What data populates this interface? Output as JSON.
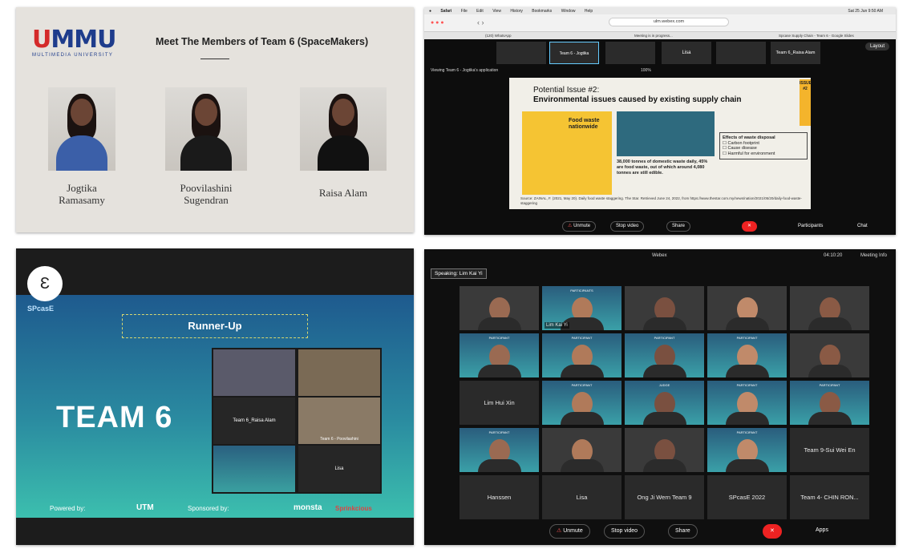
{
  "panel1": {
    "logo_text": "MMU",
    "logo_sub": "MULTIMEDIA UNIVERSITY",
    "title": "Meet The Members of Team 6 (SpaceMakers)",
    "members": [
      {
        "line1": "Jogtika",
        "line2": "Ramasamy"
      },
      {
        "line1": "Poovilashini",
        "line2": "Sugendran"
      },
      {
        "line1": "Raisa Alam",
        "line2": ""
      }
    ]
  },
  "panel2": {
    "menubar": [
      "Safari",
      "File",
      "Edit",
      "View",
      "History",
      "Bookmarks",
      "Window",
      "Help"
    ],
    "clock": "Sat 25 Jun 9:50 AM",
    "url": "ulm.webex.com",
    "tabs": [
      "(120) WhatsApp",
      "Meeting is in progress...",
      "Spcase Supply Chain - Team 6 - Google Slides"
    ],
    "strip": [
      "",
      "Team 6 - Jogtika",
      "",
      "Lisa",
      "",
      "Team 6_Raisa Alam"
    ],
    "layout_label": "Layout",
    "viewing": "Viewing Team 6 - Jogtika's application",
    "zoom": "100%",
    "slide": {
      "title1": "Potential Issue #2:",
      "title2": "Environmental issues caused by existing supply chain",
      "issue_tag": "ISSUE #2",
      "food_waste": "Food waste nationwide",
      "stats": "38,000 tonnes of domestic waste daily, 45% are food waste, out of which around 4,080 tonnes are still edible.",
      "effects_title": "Effects of waste disposal",
      "effects": [
        "Carbon footprint",
        "Cause disease",
        "Harmful for environment"
      ],
      "source": "Source: ZAINAL, F. (2021, May 20). Daily food waste staggering. The Star. Retrieved June 24, 2022, from https://www.thestar.com.my/news/nation/2021/05/20/daily-food-waste-staggering"
    },
    "controls": [
      "Unmute",
      "Stop video",
      "Share"
    ],
    "right_controls": [
      "Participants",
      "Chat"
    ]
  },
  "panel3": {
    "pen_glyph": "Ɛ",
    "spcase": "SPcasE",
    "runner_up": "Runner-Up",
    "team": "TEAM 6",
    "tiles": [
      "",
      "",
      "Team 6_Raisa Alam",
      "Team 6 - Poovilashini",
      "",
      "Lisa"
    ],
    "powered_by": "Powered by:",
    "utm": "UTM",
    "sponsored_by": "Sponsored by:",
    "monsta": "monsta",
    "sponsor2": "Sprinkcious"
  },
  "panel4": {
    "app": "Webex",
    "time": "04:10:20",
    "meeting_info": "Meeting Info",
    "speaking": "Speaking: Lim Kai Yi",
    "tiles": [
      {
        "label": "",
        "tag": "",
        "style": "face"
      },
      {
        "label": "Lim Kai Yi",
        "tag": "PARTICIPANTS",
        "style": "part"
      },
      {
        "label": "",
        "tag": "",
        "style": "face"
      },
      {
        "label": "",
        "tag": "",
        "style": "face"
      },
      {
        "label": "",
        "tag": "",
        "style": "face"
      },
      {
        "label": "",
        "tag": "PARTICIPANT",
        "style": "part"
      },
      {
        "label": "",
        "tag": "PARTICIPANT",
        "style": "part"
      },
      {
        "label": "",
        "tag": "PARTICIPANT",
        "style": "part"
      },
      {
        "label": "",
        "tag": "PARTICIPANT",
        "style": "part"
      },
      {
        "label": "",
        "tag": "",
        "style": "face"
      },
      {
        "label": "Lim Hui Xin",
        "tag": "",
        "style": "name"
      },
      {
        "label": "",
        "tag": "PARTICIPANT",
        "style": "part"
      },
      {
        "label": "",
        "tag": "JUDGE",
        "style": "part"
      },
      {
        "label": "",
        "tag": "PARTICIPANT",
        "style": "part"
      },
      {
        "label": "",
        "tag": "PARTICIPANT",
        "style": "part"
      },
      {
        "label": "",
        "tag": "PARTICIPANT",
        "style": "part"
      },
      {
        "label": "",
        "tag": "",
        "style": "face"
      },
      {
        "label": "",
        "tag": "",
        "style": "face"
      },
      {
        "label": "",
        "tag": "PARTICIPANT",
        "style": "part"
      },
      {
        "label": "Team 9-Sui Wei En",
        "tag": "",
        "style": "name"
      },
      {
        "label": "Hanssen",
        "tag": "",
        "style": "name"
      },
      {
        "label": "Lisa",
        "tag": "",
        "style": "name"
      },
      {
        "label": "Ong Ji Wern Team 9",
        "tag": "",
        "style": "name"
      },
      {
        "label": "SPcasE 2022",
        "tag": "",
        "style": "name"
      },
      {
        "label": "Team 4- CHIN RON...",
        "tag": "",
        "style": "name"
      }
    ],
    "controls": [
      "Unmute",
      "Stop video",
      "Share"
    ],
    "right": [
      "Apps"
    ]
  }
}
